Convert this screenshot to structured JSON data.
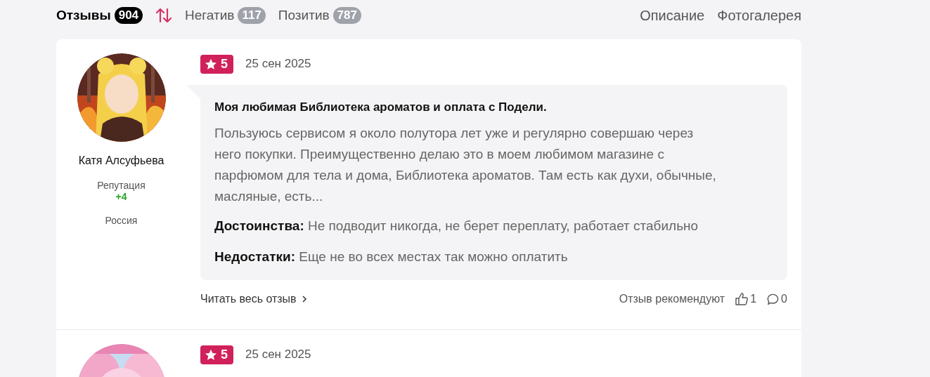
{
  "tabs": [
    {
      "label": "Отзывы",
      "count": "904",
      "selected": true
    },
    {
      "label": "Негатив",
      "count": "117",
      "selected": false
    },
    {
      "label": "Позитив",
      "count": "787",
      "selected": false
    }
  ],
  "links": [
    "Описание",
    "Фотогалерея"
  ],
  "reviews": [
    {
      "author": "Катя Алсуфьева",
      "reputation_label": "Репутация",
      "reputation": "+4",
      "country": "Россия",
      "rating": "5",
      "date": "25 сен 2025",
      "title": "Моя любимая Библиотека ароматов и оплата с Подели.",
      "text": "Пользуюсь сервисом я около полутора лет уже и регулярно совершаю через него покупки. Преимущественно делаю это в моем любимом магазине с парфюмом для тела и дома, Библиотека ароматов. Там есть как духи, обычные, масляные, есть...",
      "pros": "**Достоинства:** Не подводит никогда, не берет переплату, работает стабильно",
      "cons": "**Недостатки:** Еще не во всех местах так можно оплатить",
      "read_more": "Читать весь отзыв",
      "recommend_label": "Отзыв рекомендуют",
      "likes": "1",
      "comments": "0"
    },
    {
      "rating": "5",
      "date": "25 сен 2025"
    }
  ]
}
